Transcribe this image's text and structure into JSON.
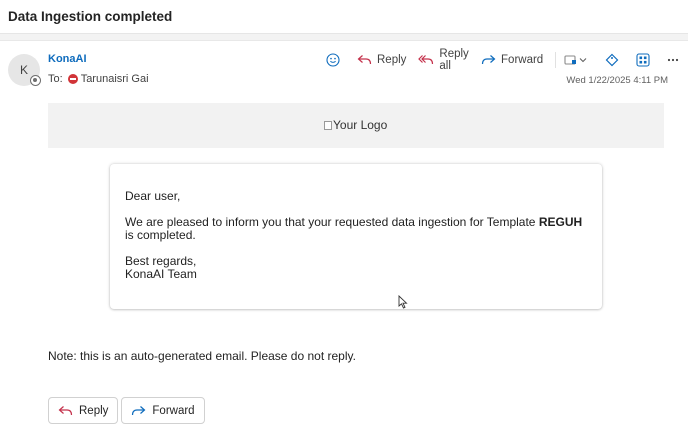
{
  "subject": "Data Ingestion completed",
  "sender": {
    "initial": "K",
    "name": "KonaAI"
  },
  "recipient": {
    "prefix": "To:",
    "name": "Tarunaisri Gai"
  },
  "toolbar": {
    "reply": "Reply",
    "reply_all": "Reply all",
    "forward": "Forward"
  },
  "date": "Wed 1/22/2025 4:11 PM",
  "logo_alt": "Your Logo",
  "body": {
    "greeting": "Dear user,",
    "line1_prefix": "We are pleased to inform you that your requested data ingestion for Template",
    "template_name": "REGUH",
    "line1_suffix": "is completed.",
    "closing": "Best regards,",
    "team": "KonaAI Team"
  },
  "note": "Note: this is an auto-generated email. Please do not reply.",
  "actions": {
    "reply": "Reply",
    "forward": "Forward"
  },
  "colors": {
    "accent": "#0f6cbd",
    "reply_icon": "#c4314b",
    "dnd": "#d13438"
  }
}
